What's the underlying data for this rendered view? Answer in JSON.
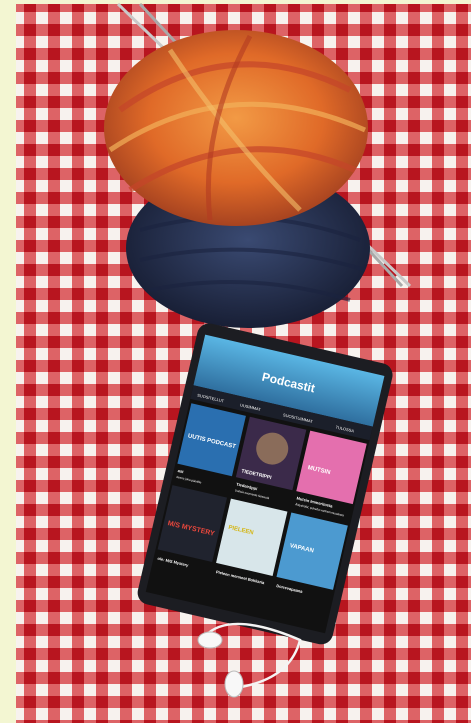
{
  "colors": {
    "background_cream": "#f3f6d2",
    "tablecloth_red": "#c8232c",
    "tablecloth_white": "#f7f2ee",
    "yarn_orange": "#e6762b",
    "yarn_navy": "#26324f",
    "tablet_body": "#1c1d22",
    "app_header_blue": "#4aa3d6"
  },
  "tablet": {
    "app_title": "Podcastit",
    "tabs": [
      "SUOSITELLUT",
      "UUSIMMAT",
      "SUOSITUIMMAT",
      "TULOSSA"
    ],
    "tiles_row1": [
      {
        "label": "ast",
        "caption": "deens joka päivälle",
        "art": "UUTIS PODCAST"
      },
      {
        "label": "Tiedeträppi",
        "caption": "Uutisia suomesta tieteestä",
        "art": "TIEDETRIPPI"
      },
      {
        "label": "Mutsin Immeritosta",
        "caption": "Äitiyshölst, puhetta vanhemmuudesta",
        "art": "MUTSIN"
      }
    ],
    "tiles_row2": [
      {
        "label": "ole: M/S Mystery",
        "art": "M/S MYSTERY"
      },
      {
        "label": "Pieleen menneet Bokkaria",
        "art": "PIELEEN"
      },
      {
        "label": "Dorrevapaana",
        "art": "VAPAAN"
      }
    ]
  }
}
